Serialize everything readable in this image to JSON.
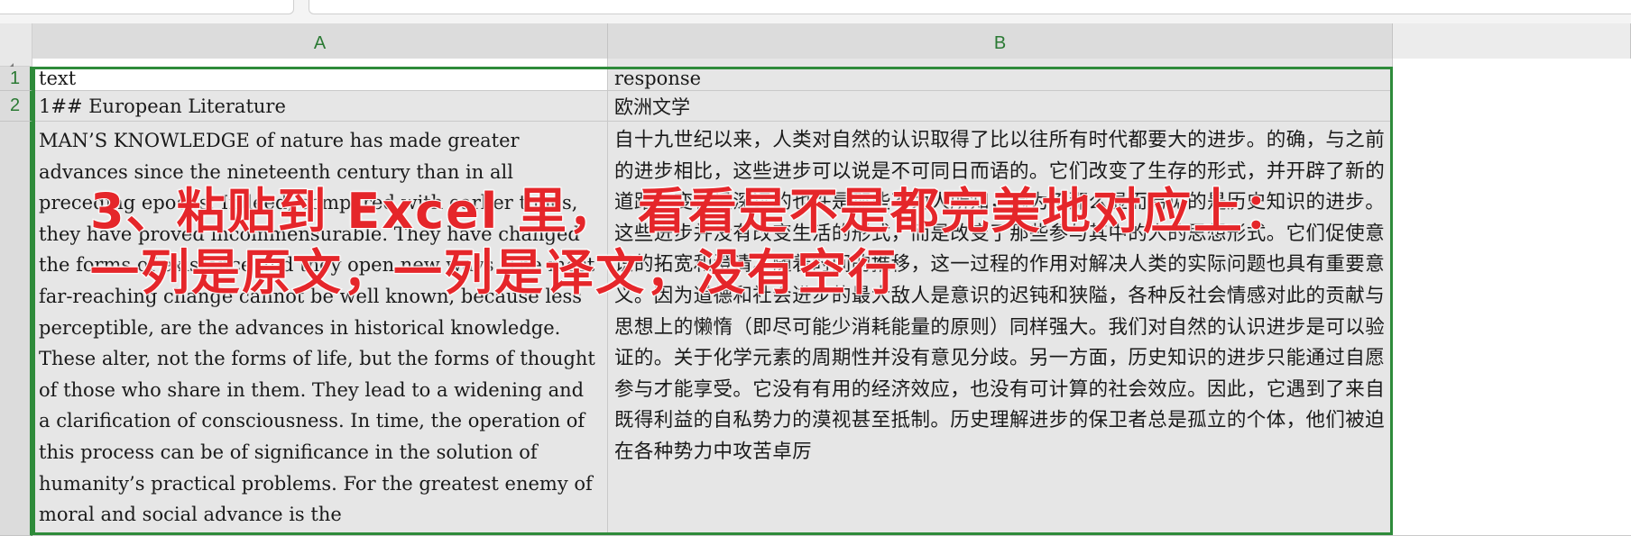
{
  "sheet": {
    "columns": [
      "A",
      "B"
    ],
    "rows": [
      "1",
      "2"
    ],
    "cells": {
      "A1": "text",
      "B1": "response",
      "A2": "1## European Literature",
      "B2": "欧洲文学",
      "A3": "MAN’S KNOWLEDGE of nature has made greater advances since the nineteenth century than in all preceding epochs. Indeed, compared with earlier times, they have proved incommensurable. They have changed the forms of existence and they open new ways. The most far-reaching change cannot be well known, because less perceptible, are the advances in historical knowledge. These alter, not the forms of life, but the forms of thought of those who share in them. They lead to a widening and a clarification of consciousness. In time, the operation of this process can be of significance in the solution of humanity’s practical problems. For the greatest enemy of moral and social advance is the",
      "B3": "自十九世纪以来，人类对自然的认识取得了比以往所有时代都要大的进步。的确，与之前的进步相比，这些进步可以说是不可同日而语的。它们改变了生存的形式，并开辟了新的道路。变化最深远的也许是那些不为人所知，因为不那么显而易见的是历史知识的进步。这些进步并没有改变生活的形式，而是改变了那些参与其中的人的思想形式。它们促使意识的拓宽和澄清。随着时间的推移，这一过程的作用对解决人类的实际问题也具有重要意义。因为道德和社会进步的最大敌人是意识的迟钝和狭隘，各种反社会情感对此的贡献与思想上的懒惰（即尽可能少消耗能量的原则）同样强大。我们对自然的认识进步是可以验证的。关于化学元素的周期性并没有意见分歧。另一方面，历史知识的进步只能通过自愿参与才能享受。它没有有用的经济效应，也没有可计算的社会效应。因此，它遇到了来自既得利益的自私势力的漠视甚至抵制。历史理解进步的保卫者总是孤立的个体，他们被迫在各种势力中攻苦卓厉"
    }
  },
  "overlay": {
    "line1": "3、粘贴到 Excel 里， 看看是不是都完美地对应上：",
    "line2": "一列是原文，一列是译文，没有空行"
  },
  "colors": {
    "selection": "#2e8b3a",
    "header_text": "#2b7a34",
    "overlay_text": "#e5262a"
  }
}
